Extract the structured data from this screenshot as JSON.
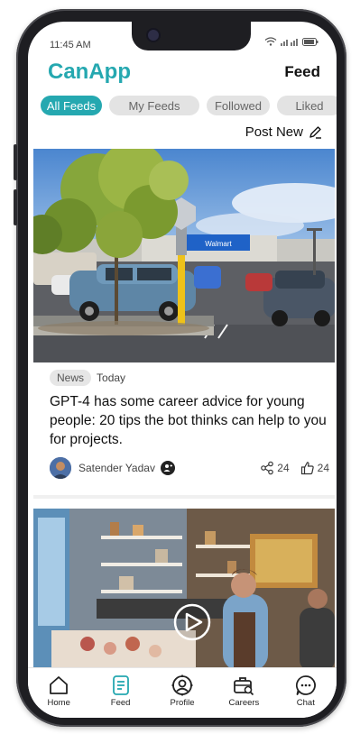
{
  "status_bar": {
    "time": "11:45 AM"
  },
  "header": {
    "app_name": "CanApp",
    "section": "Feed"
  },
  "tabs": [
    {
      "label": "All Feeds",
      "active": true
    },
    {
      "label": "My Feeds",
      "active": false
    },
    {
      "label": "Followed",
      "active": false
    },
    {
      "label": "Liked",
      "active": false
    }
  ],
  "post_new": {
    "label": "Post New",
    "icon": "pencil-icon"
  },
  "posts": [
    {
      "category": "News",
      "date": "Today",
      "headline": "GPT-4 has some career advice for young people: 20 tips the bot thinks can help to you for projects.",
      "author": "Satender Yadav",
      "shares": "24",
      "likes": "24",
      "store_sign": "Walmart"
    }
  ],
  "nav": [
    {
      "label": "Home",
      "icon": "home-icon",
      "active": false
    },
    {
      "label": "Feed",
      "icon": "feed-icon",
      "active": true
    },
    {
      "label": "Profile",
      "icon": "profile-icon",
      "active": false
    },
    {
      "label": "Careers",
      "icon": "careers-icon",
      "active": false
    },
    {
      "label": "Chat",
      "icon": "chat-icon",
      "active": false
    }
  ],
  "colors": {
    "accent": "#25a8b0",
    "tab_inactive": "#e3e3e3",
    "frame": "#1e1e22"
  }
}
